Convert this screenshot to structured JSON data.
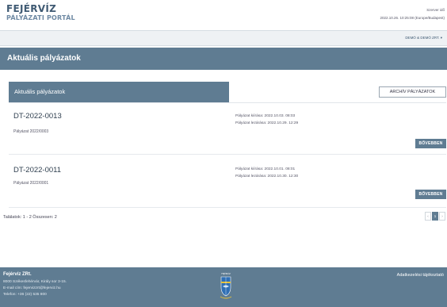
{
  "header": {
    "logo_line1": "FEJÉRVÍZ",
    "logo_line2": "PÁLYÁZATI PORTÁL",
    "server_label": "Szerver idő",
    "server_time": "2022.10.26. 10:25:08 (Europe/Budapest)"
  },
  "userbar": {
    "user_menu": "DEMÓ & DEMÓ ZRT. ▾"
  },
  "page": {
    "title": "Aktuális pályázatok"
  },
  "section": {
    "title": "Aktuális pályázatok",
    "archive_button": "ARCHÍV PÁLYÁZATOK"
  },
  "items": [
    {
      "code": "DT-2022-0013",
      "name": "Pályázat 2022/0003",
      "issued": "Pályázat kiírása: 2022.10.03. 08:03",
      "closes": "Pályázat lezárása: 2022.10.29. 12:29",
      "more": "BŐVEBBEN"
    },
    {
      "code": "DT-2022-0011",
      "name": "Pályázat 2022/0001",
      "issued": "Pályázat kiírása: 2022.10.01. 08:01",
      "closes": "Pályázat lezárása: 2022.10.30. 12:30",
      "more": "BŐVEBBEN"
    }
  ],
  "results": "Találatok: 1 - 2 Összesen: 2",
  "pager": {
    "prev": "‹",
    "current": "1",
    "next": "›"
  },
  "footer": {
    "company": "Fejérvíz ZRt.",
    "address": "8000 Székesfehérvár, Király sor 3-15.",
    "email": "E-mail cím: fejervizzrt@fejerviz.hu",
    "phone": "Telefon: +36 (22) 535 800",
    "privacy_link": "Adatkezelési tájékoztató",
    "crest_label": "FEJÉRVÍZ"
  },
  "colors": {
    "accent": "#5f7c92",
    "brand_dark": "#3f5a73"
  }
}
